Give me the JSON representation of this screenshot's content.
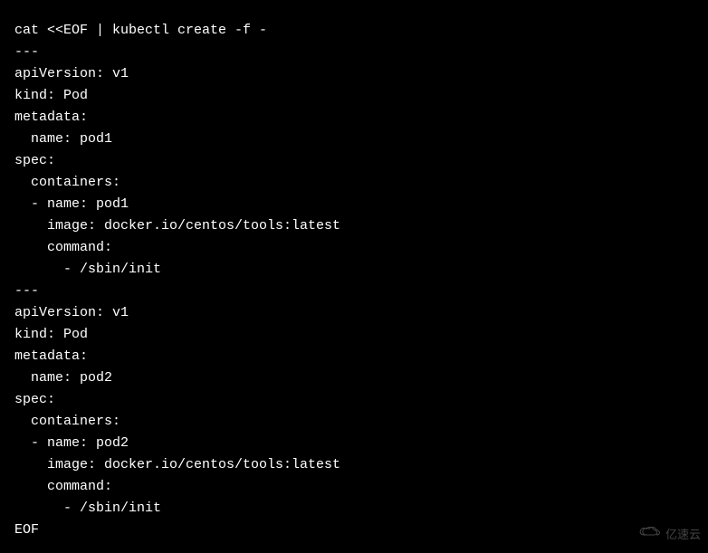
{
  "terminal": {
    "lines": [
      "cat <<EOF | kubectl create -f -",
      "---",
      "apiVersion: v1",
      "kind: Pod",
      "metadata:",
      "  name: pod1",
      "spec:",
      "  containers:",
      "  - name: pod1",
      "    image: docker.io/centos/tools:latest",
      "    command:",
      "      - /sbin/init",
      "---",
      "apiVersion: v1",
      "kind: Pod",
      "metadata:",
      "  name: pod2",
      "spec:",
      "  containers:",
      "  - name: pod2",
      "    image: docker.io/centos/tools:latest",
      "    command:",
      "      - /sbin/init",
      "EOF"
    ]
  },
  "watermark": {
    "text": "亿速云"
  }
}
